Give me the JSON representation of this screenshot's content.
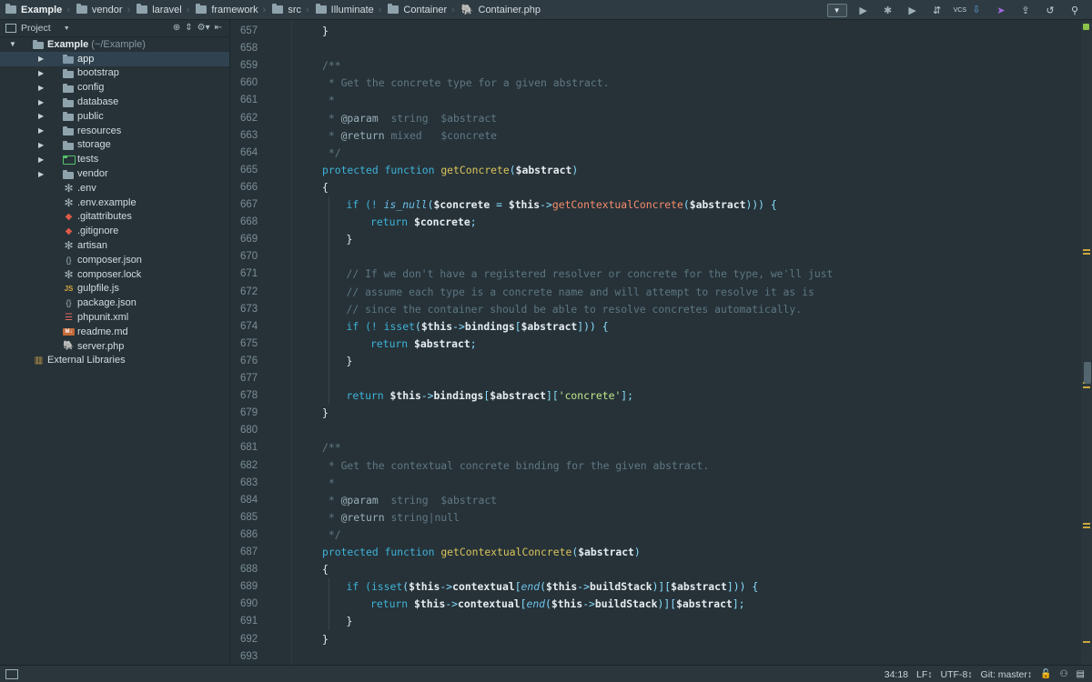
{
  "breadcrumbs": [
    {
      "label": "Example",
      "type": "folder",
      "bold": true
    },
    {
      "label": "vendor",
      "type": "folder"
    },
    {
      "label": "laravel",
      "type": "folder"
    },
    {
      "label": "framework",
      "type": "folder"
    },
    {
      "label": "src",
      "type": "folder"
    },
    {
      "label": "Illuminate",
      "type": "folder"
    },
    {
      "label": "Container",
      "type": "folder"
    },
    {
      "label": "Container.php",
      "type": "php-file"
    }
  ],
  "toolbar": {
    "vcs_label": "VCS",
    "icons": [
      "run-config-dropdown-icon",
      "run-icon",
      "debug-icon",
      "coverage-icon",
      "attach-icon",
      "vcs-update-icon",
      "vcs-commit-icon",
      "vcs-push-icon",
      "history-icon",
      "search-everywhere-icon"
    ]
  },
  "project_panel": {
    "title": "Project",
    "root": {
      "label": "Example",
      "path": "(~/Example)"
    },
    "tree": [
      {
        "label": "app",
        "icon": "folder-app",
        "arrow": true,
        "selected": true
      },
      {
        "label": "bootstrap",
        "icon": "folder",
        "arrow": true
      },
      {
        "label": "config",
        "icon": "folder",
        "arrow": true
      },
      {
        "label": "database",
        "icon": "folder",
        "arrow": true
      },
      {
        "label": "public",
        "icon": "folder",
        "arrow": true
      },
      {
        "label": "resources",
        "icon": "folder",
        "arrow": true
      },
      {
        "label": "storage",
        "icon": "folder",
        "arrow": true
      },
      {
        "label": "tests",
        "icon": "folder-test",
        "arrow": true
      },
      {
        "label": "vendor",
        "icon": "folder",
        "arrow": true
      },
      {
        "label": ".env",
        "icon": "star"
      },
      {
        "label": ".env.example",
        "icon": "star"
      },
      {
        "label": ".gitattributes",
        "icon": "git"
      },
      {
        "label": ".gitignore",
        "icon": "git"
      },
      {
        "label": "artisan",
        "icon": "star"
      },
      {
        "label": "composer.json",
        "icon": "json"
      },
      {
        "label": "composer.lock",
        "icon": "star"
      },
      {
        "label": "gulpfile.js",
        "icon": "js"
      },
      {
        "label": "package.json",
        "icon": "json"
      },
      {
        "label": "phpunit.xml",
        "icon": "xml"
      },
      {
        "label": "readme.md",
        "icon": "md"
      },
      {
        "label": "server.php",
        "icon": "php"
      }
    ],
    "external_libraries": "External Libraries"
  },
  "editor": {
    "lines": [
      {
        "n": "657",
        "indent": 0,
        "tokens": [
          {
            "t": "}",
            "c": "plain"
          }
        ]
      },
      {
        "n": "658",
        "indent": 0,
        "tokens": []
      },
      {
        "n": "659",
        "indent": 0,
        "tokens": [
          {
            "t": "/**",
            "c": "doc"
          }
        ]
      },
      {
        "n": "660",
        "indent": 0,
        "tokens": [
          {
            "t": " * Get the concrete type for a given abstract.",
            "c": "doc"
          }
        ]
      },
      {
        "n": "661",
        "indent": 0,
        "tokens": [
          {
            "t": " *",
            "c": "doc"
          }
        ]
      },
      {
        "n": "662",
        "indent": 0,
        "tokens": [
          {
            "t": " * ",
            "c": "doc"
          },
          {
            "t": "@param",
            "c": "tag"
          },
          {
            "t": "  string  $abstract",
            "c": "doc"
          }
        ]
      },
      {
        "n": "663",
        "indent": 0,
        "tokens": [
          {
            "t": " * ",
            "c": "doc"
          },
          {
            "t": "@return",
            "c": "tag"
          },
          {
            "t": " mixed   $concrete",
            "c": "doc"
          }
        ]
      },
      {
        "n": "664",
        "indent": 0,
        "tokens": [
          {
            "t": " */",
            "c": "doc"
          }
        ]
      },
      {
        "n": "665",
        "indent": 0,
        "tokens": [
          {
            "t": "protected function ",
            "c": "kw"
          },
          {
            "t": "getConcrete",
            "c": "fn2"
          },
          {
            "t": "(",
            "c": "sym"
          },
          {
            "t": "$abstract",
            "c": "var"
          },
          {
            "t": ")",
            "c": "sym"
          }
        ]
      },
      {
        "n": "666",
        "indent": 0,
        "tokens": [
          {
            "t": "{",
            "c": "plain"
          }
        ]
      },
      {
        "n": "667",
        "indent": 1,
        "tokens": [
          {
            "t": "if (! ",
            "c": "kw"
          },
          {
            "t": "is_null",
            "c": "it"
          },
          {
            "t": "(",
            "c": "sym"
          },
          {
            "t": "$concrete",
            "c": "var"
          },
          {
            "t": " = ",
            "c": "op"
          },
          {
            "t": "$this",
            "c": "var"
          },
          {
            "t": "->",
            "c": "op"
          },
          {
            "t": "getContextualConcrete",
            "c": "fn"
          },
          {
            "t": "(",
            "c": "sym"
          },
          {
            "t": "$abstract",
            "c": "var"
          },
          {
            "t": "))) {",
            "c": "sym"
          }
        ]
      },
      {
        "n": "668",
        "indent": 2,
        "tokens": [
          {
            "t": "return ",
            "c": "kw"
          },
          {
            "t": "$concrete",
            "c": "var"
          },
          {
            "t": ";",
            "c": "sym"
          }
        ]
      },
      {
        "n": "669",
        "indent": 1,
        "tokens": [
          {
            "t": "}",
            "c": "plain"
          }
        ]
      },
      {
        "n": "670",
        "indent": 0,
        "tokens": []
      },
      {
        "n": "671",
        "indent": 1,
        "tokens": [
          {
            "t": "// If we don't have a registered resolver or concrete for the type, we'll just",
            "c": "cm"
          }
        ]
      },
      {
        "n": "672",
        "indent": 1,
        "tokens": [
          {
            "t": "// assume each type is a concrete name and will attempt to resolve it as is",
            "c": "cm"
          }
        ]
      },
      {
        "n": "673",
        "indent": 1,
        "tokens": [
          {
            "t": "// since the container should be able to resolve concretes automatically.",
            "c": "cm"
          }
        ]
      },
      {
        "n": "674",
        "indent": 1,
        "tokens": [
          {
            "t": "if (! ",
            "c": "kw"
          },
          {
            "t": "isset",
            "c": "kw"
          },
          {
            "t": "(",
            "c": "sym"
          },
          {
            "t": "$this",
            "c": "var"
          },
          {
            "t": "->",
            "c": "op"
          },
          {
            "t": "bindings",
            "c": "var"
          },
          {
            "t": "[",
            "c": "sym"
          },
          {
            "t": "$abstract",
            "c": "var"
          },
          {
            "t": "])) {",
            "c": "sym"
          }
        ]
      },
      {
        "n": "675",
        "indent": 2,
        "tokens": [
          {
            "t": "return ",
            "c": "kw"
          },
          {
            "t": "$abstract",
            "c": "var"
          },
          {
            "t": ";",
            "c": "sym"
          }
        ]
      },
      {
        "n": "676",
        "indent": 1,
        "tokens": [
          {
            "t": "}",
            "c": "plain"
          }
        ]
      },
      {
        "n": "677",
        "indent": 0,
        "tokens": []
      },
      {
        "n": "678",
        "indent": 1,
        "tokens": [
          {
            "t": "return ",
            "c": "kw"
          },
          {
            "t": "$this",
            "c": "var"
          },
          {
            "t": "->",
            "c": "op"
          },
          {
            "t": "bindings",
            "c": "var"
          },
          {
            "t": "[",
            "c": "sym"
          },
          {
            "t": "$abstract",
            "c": "var"
          },
          {
            "t": "][",
            "c": "sym"
          },
          {
            "t": "'concrete'",
            "c": "str"
          },
          {
            "t": "];",
            "c": "sym"
          }
        ]
      },
      {
        "n": "679",
        "indent": 0,
        "tokens": [
          {
            "t": "}",
            "c": "plain"
          }
        ]
      },
      {
        "n": "680",
        "indent": 0,
        "tokens": []
      },
      {
        "n": "681",
        "indent": 0,
        "tokens": [
          {
            "t": "/**",
            "c": "doc"
          }
        ]
      },
      {
        "n": "682",
        "indent": 0,
        "tokens": [
          {
            "t": " * Get the contextual concrete binding for the given abstract.",
            "c": "doc"
          }
        ]
      },
      {
        "n": "683",
        "indent": 0,
        "tokens": [
          {
            "t": " *",
            "c": "doc"
          }
        ]
      },
      {
        "n": "684",
        "indent": 0,
        "tokens": [
          {
            "t": " * ",
            "c": "doc"
          },
          {
            "t": "@param",
            "c": "tag"
          },
          {
            "t": "  string  $abstract",
            "c": "doc"
          }
        ]
      },
      {
        "n": "685",
        "indent": 0,
        "tokens": [
          {
            "t": " * ",
            "c": "doc"
          },
          {
            "t": "@return",
            "c": "tag"
          },
          {
            "t": " string|null",
            "c": "doc"
          }
        ]
      },
      {
        "n": "686",
        "indent": 0,
        "tokens": [
          {
            "t": " */",
            "c": "doc"
          }
        ]
      },
      {
        "n": "687",
        "indent": 0,
        "tokens": [
          {
            "t": "protected function ",
            "c": "kw"
          },
          {
            "t": "getContextualConcrete",
            "c": "fn2"
          },
          {
            "t": "(",
            "c": "sym"
          },
          {
            "t": "$abstract",
            "c": "var"
          },
          {
            "t": ")",
            "c": "sym"
          }
        ]
      },
      {
        "n": "688",
        "indent": 0,
        "tokens": [
          {
            "t": "{",
            "c": "plain"
          }
        ]
      },
      {
        "n": "689",
        "indent": 1,
        "tokens": [
          {
            "t": "if (",
            "c": "kw"
          },
          {
            "t": "isset",
            "c": "kw"
          },
          {
            "t": "(",
            "c": "sym"
          },
          {
            "t": "$this",
            "c": "var"
          },
          {
            "t": "->",
            "c": "op"
          },
          {
            "t": "contextual",
            "c": "var"
          },
          {
            "t": "[",
            "c": "sym"
          },
          {
            "t": "end",
            "c": "it"
          },
          {
            "t": "(",
            "c": "sym"
          },
          {
            "t": "$this",
            "c": "var"
          },
          {
            "t": "->",
            "c": "op"
          },
          {
            "t": "buildStack",
            "c": "var"
          },
          {
            "t": ")][",
            "c": "sym"
          },
          {
            "t": "$abstract",
            "c": "var"
          },
          {
            "t": "])) {",
            "c": "sym"
          }
        ]
      },
      {
        "n": "690",
        "indent": 2,
        "tokens": [
          {
            "t": "return ",
            "c": "kw"
          },
          {
            "t": "$this",
            "c": "var"
          },
          {
            "t": "->",
            "c": "op"
          },
          {
            "t": "contextual",
            "c": "var"
          },
          {
            "t": "[",
            "c": "sym"
          },
          {
            "t": "end",
            "c": "it"
          },
          {
            "t": "(",
            "c": "sym"
          },
          {
            "t": "$this",
            "c": "var"
          },
          {
            "t": "->",
            "c": "op"
          },
          {
            "t": "buildStack",
            "c": "var"
          },
          {
            "t": ")][",
            "c": "sym"
          },
          {
            "t": "$abstract",
            "c": "var"
          },
          {
            "t": "];",
            "c": "sym"
          }
        ]
      },
      {
        "n": "691",
        "indent": 1,
        "tokens": [
          {
            "t": "}",
            "c": "plain"
          }
        ]
      },
      {
        "n": "692",
        "indent": 0,
        "tokens": [
          {
            "t": "}",
            "c": "plain"
          }
        ]
      },
      {
        "n": "693",
        "indent": 0,
        "tokens": []
      }
    ]
  },
  "status": {
    "position": "34:18",
    "line_separator": "LF↕",
    "encoding": "UTF-8↕",
    "git": "Git: master↕"
  },
  "colors": {
    "background": "#263238",
    "keyword": "#3fb3d8",
    "function_decl": "#dcc45b",
    "function_call": "#f78c6c",
    "string": "#c3e88d",
    "comment": "#5e7682",
    "test_folder": "#55c26c"
  }
}
